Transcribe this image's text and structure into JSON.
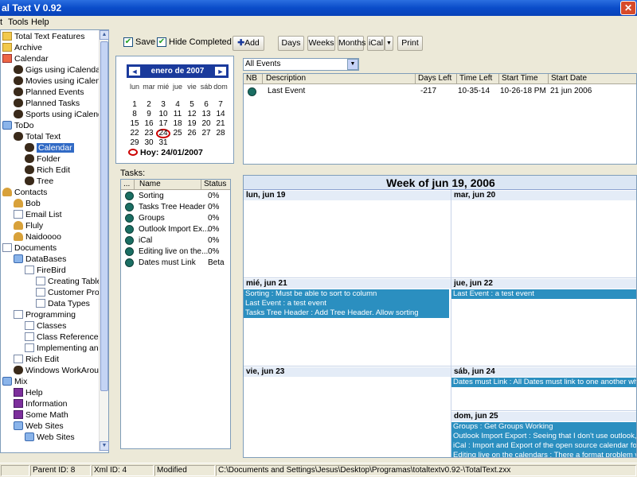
{
  "window": {
    "title": "al Text V 0.92",
    "close_glyph": "✕"
  },
  "menu": [
    "t",
    "Tools",
    "Help"
  ],
  "tree": [
    {
      "label": "Total Text Features",
      "icon": "folder-icon"
    },
    {
      "label": "Archive",
      "icon": "folder-icon"
    },
    {
      "label": "Calendar",
      "icon": "calendar-icon"
    },
    {
      "label": "Gigs using iCalendar",
      "icon": "bear-icon"
    },
    {
      "label": "Movies using iCalendar",
      "icon": "bear-icon"
    },
    {
      "label": "Planned Events",
      "icon": "bear-icon"
    },
    {
      "label": "Planned Tasks",
      "icon": "bear-icon"
    },
    {
      "label": "Sports using iCalendar",
      "icon": "bear-icon"
    },
    {
      "label": "ToDo",
      "icon": "blue-icon"
    },
    {
      "label": "Total Text",
      "icon": "bear-icon"
    },
    {
      "label": "Calendar",
      "icon": "bear-icon"
    },
    {
      "label": "Folder",
      "icon": "bear-icon"
    },
    {
      "label": "Rich Edit",
      "icon": "bear-icon"
    },
    {
      "label": "Tree",
      "icon": "bear-icon"
    },
    {
      "label": "Contacts",
      "icon": "person-icon"
    },
    {
      "label": "Bob",
      "icon": "person-icon"
    },
    {
      "label": "Email List",
      "icon": "doc-icon"
    },
    {
      "label": "Fluly",
      "icon": "person-icon"
    },
    {
      "label": "Naidoooo",
      "icon": "person-icon"
    },
    {
      "label": "Documents",
      "icon": "doc-icon"
    },
    {
      "label": "DataBases",
      "icon": "blue-icon"
    },
    {
      "label": "FireBird",
      "icon": "doc-icon"
    },
    {
      "label": "Creating Tables",
      "icon": "doc-icon"
    },
    {
      "label": "Customer Profile",
      "icon": "doc-icon"
    },
    {
      "label": "Data Types",
      "icon": "doc-icon"
    },
    {
      "label": "Programming",
      "icon": "doc-icon"
    },
    {
      "label": "Classes",
      "icon": "doc-icon"
    },
    {
      "label": "Class Reference",
      "icon": "doc-icon"
    },
    {
      "label": "Implementing an Interfa",
      "icon": "doc-icon"
    },
    {
      "label": "Rich Edit",
      "icon": "doc-icon"
    },
    {
      "label": "Windows WorkArounds",
      "icon": "bear-icon"
    },
    {
      "label": "Mix",
      "icon": "blue-icon"
    },
    {
      "label": "Help",
      "icon": "book-icon"
    },
    {
      "label": "Information",
      "icon": "book-icon"
    },
    {
      "label": "Some Math",
      "icon": "book-icon"
    },
    {
      "label": "Web Sites",
      "icon": "blue-icon"
    },
    {
      "label": "Web Sites",
      "icon": "blue-icon"
    }
  ],
  "toolbar": {
    "save_label": "Save",
    "save_checked": true,
    "hide_completed_label": "Hide Completed",
    "hide_completed_checked": true,
    "add_label": "Add",
    "add_icon": "plus-icon",
    "days_label": "Days",
    "weeks_label": "Weeks",
    "months_label": "Months",
    "ical_label": "iCal",
    "print_label": "Print"
  },
  "calendar": {
    "month_label": "enero de 2007",
    "prev_glyph": "◄",
    "next_glyph": "►",
    "weekdays": [
      "lun",
      "mar",
      "mié",
      "jue",
      "vie",
      "sáb",
      "dom"
    ],
    "first_weekday_index": 0,
    "days_in_month": 31,
    "selected_day": 24,
    "today_label": "Hoy: 24/01/2007"
  },
  "tasks": {
    "label": "Tasks:",
    "columns": [
      "...",
      "Name",
      "Status"
    ],
    "rows": [
      {
        "name": "Sorting",
        "status": "0%"
      },
      {
        "name": "Tasks Tree Header",
        "status": "0%"
      },
      {
        "name": "Groups",
        "status": "0%"
      },
      {
        "name": "Outlook Import Ex...",
        "status": "0%"
      },
      {
        "name": "iCal",
        "status": "0%"
      },
      {
        "name": "Editing live on the...",
        "status": "0%"
      },
      {
        "name": "Dates must Link",
        "status": "Beta"
      }
    ]
  },
  "events_filter": {
    "value": "All Events"
  },
  "events": {
    "columns": [
      "NB",
      "Description",
      "Days Left",
      "Time Left",
      "Start Time",
      "Start Date"
    ],
    "rows": [
      {
        "description": "Last Event",
        "days_left": "-217",
        "time_left": "10-35-14",
        "start_time": "10-26-18 PM",
        "start_date": "21 jun 2006"
      }
    ]
  },
  "week": {
    "title": "Week of jun 19, 2006",
    "days": [
      {
        "label": "lun, jun 19",
        "events": []
      },
      {
        "label": "mar, jun 20",
        "events": []
      },
      {
        "label": "mié, jun 21",
        "events": [
          "Sorting : Must be able to sort to column",
          "Last Event : a test event",
          "Tasks Tree Header : Add Tree Header. Allow sorting"
        ]
      },
      {
        "label": "jue, jun 22",
        "events": [
          "Last Event : a test event"
        ]
      },
      {
        "label": "vie, jun 23",
        "events": []
      },
      {
        "label": "sáb, jun 24",
        "events": [
          "Dates must Link : All Dates must link to one another when selec"
        ]
      },
      {
        "label": "dom, jun 25",
        "events": [
          "Groups : Get Groups Working",
          "Outlook Import Export : Seeing that I don't use outlook, this ain't",
          "iCal : Import and Export of the open source calendar format. Us",
          "Editing live on the calendars : There a format problem when edi"
        ]
      }
    ]
  },
  "status": {
    "parent_id": "Parent ID: 8",
    "xml_id": "Xml ID: 4",
    "modified": "Modified",
    "path": "C:\\Documents and Settings\\Jesus\\Desktop\\Programas\\totaltextv0.92-\\TotalText.zxx"
  },
  "colors": {
    "accent": "#316ac5",
    "event_bar": "#2b8fc0",
    "title_bar": "#0a4cc9"
  }
}
